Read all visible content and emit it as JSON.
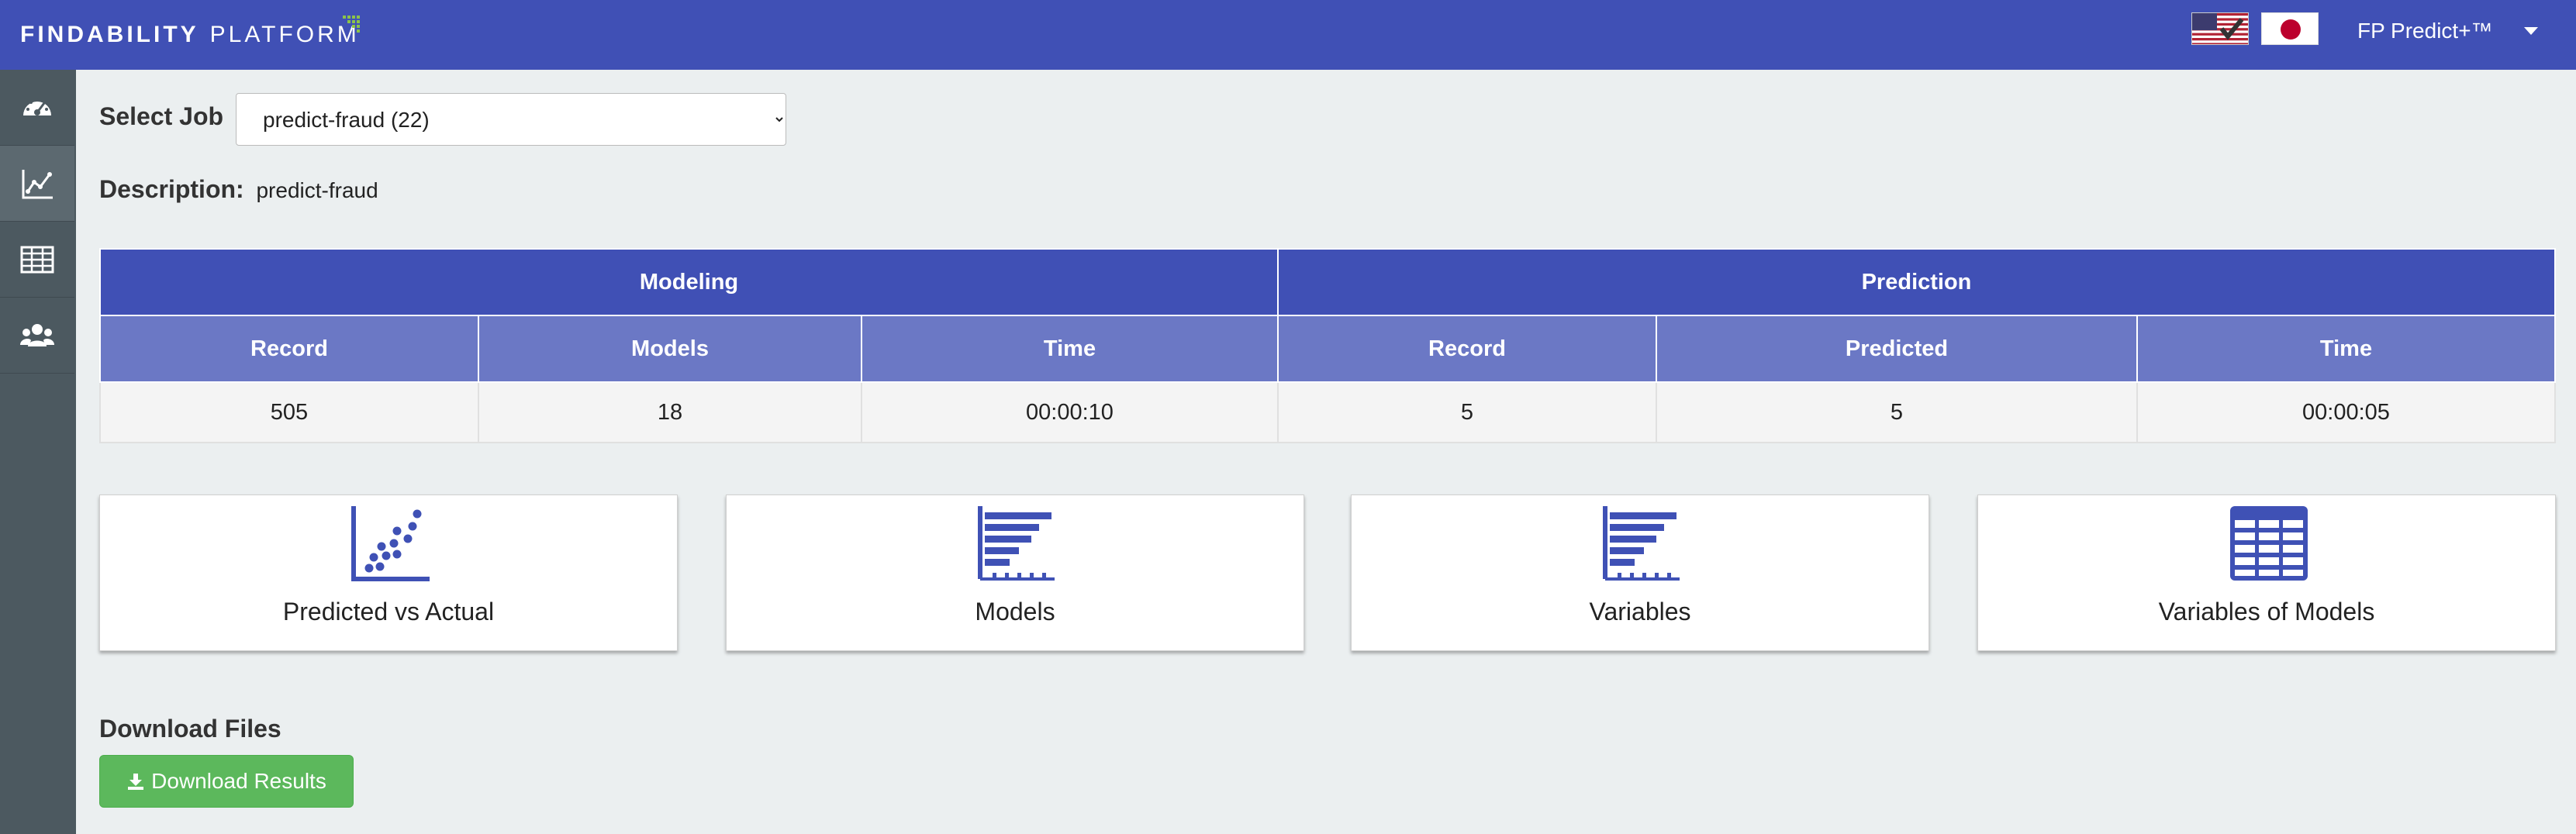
{
  "header": {
    "logo_bold": "FINDABILITY",
    "logo_light": "PLATFORM",
    "product_menu_label": "FP Predict+™",
    "brand_color": "#4050b5"
  },
  "sidebar": {
    "items": [
      {
        "icon": "dashboard-gauge-icon",
        "active": false
      },
      {
        "icon": "line-chart-icon",
        "active": true
      },
      {
        "icon": "table-icon",
        "active": false
      },
      {
        "icon": "users-icon",
        "active": false
      }
    ]
  },
  "job": {
    "label": "Select Job",
    "selected": "predict-fraud (22)",
    "description_label": "Description:",
    "description_value": "predict-fraud"
  },
  "summary": {
    "groups": [
      "Modeling",
      "Prediction"
    ],
    "headers": [
      "Record",
      "Models",
      "Time",
      "Record",
      "Predicted",
      "Time"
    ],
    "values": [
      "505",
      "18",
      "00:00:10",
      "5",
      "5",
      "00:00:05"
    ]
  },
  "cards": [
    {
      "label": "Predicted vs Actual",
      "icon": "scatter-plot-icon"
    },
    {
      "label": "Models",
      "icon": "bar-chart-icon"
    },
    {
      "label": "Variables",
      "icon": "bar-chart-icon"
    },
    {
      "label": "Variables of Models",
      "icon": "table-grid-icon"
    }
  ],
  "download": {
    "title": "Download Files",
    "button_label": "Download Results",
    "button_color": "#5cb85c"
  }
}
